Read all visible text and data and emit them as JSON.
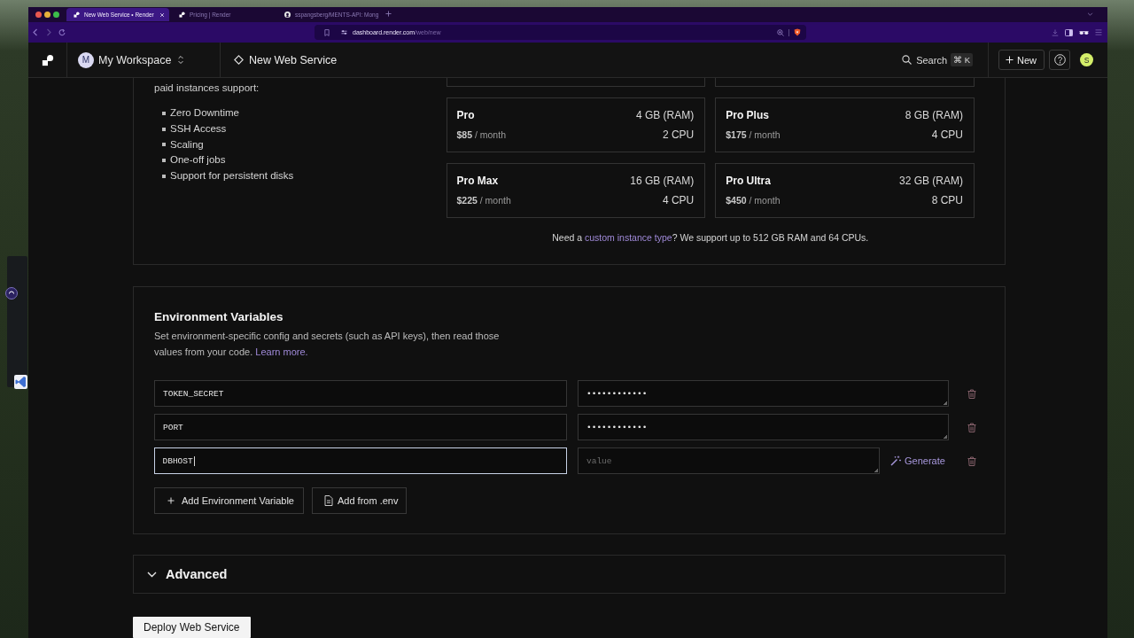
{
  "browser": {
    "tabs": [
      {
        "title": "New Web Service • Render",
        "kind": "blocks",
        "selected": true,
        "closable": true
      },
      {
        "title": "Pricing | Render",
        "kind": "blocks",
        "selected": false,
        "closable": false
      },
      {
        "title": "sspangsberg/MENTS-API: Mong",
        "kind": "round",
        "selected": false,
        "closable": false
      }
    ],
    "url": {
      "host": "dashboard.render.com",
      "path": "/web/new"
    }
  },
  "header": {
    "workspace": {
      "initial": "M",
      "name": "My Workspace"
    },
    "page_title": "New Web Service",
    "search": {
      "label": "Search",
      "shortcut": "⌘ K"
    },
    "new_button": "New",
    "user_initial": "S"
  },
  "instances": {
    "intro": "paid instances support:",
    "features": [
      "Zero Downtime",
      "SSH Access",
      "Scaling",
      "One-off jobs",
      "Support for persistent disks"
    ],
    "types": [
      {
        "kind": "partial"
      },
      {
        "kind": "partial"
      },
      {
        "kind": "full",
        "name": "Pro",
        "ram": "4 GB (RAM)",
        "price": "**$85** / month",
        "cpu": "2 CPU"
      },
      {
        "kind": "full",
        "name": "Pro Plus",
        "ram": "8 GB (RAM)",
        "price": "**$175** / month",
        "cpu": "4 CPU"
      },
      {
        "kind": "full",
        "name": "Pro Max",
        "ram": "16 GB (RAM)",
        "price": "**$225** / month",
        "cpu": "4 CPU"
      },
      {
        "kind": "full",
        "name": "Pro Ultra",
        "ram": "32 GB (RAM)",
        "price": "**$450** / month",
        "cpu": "8 CPU"
      }
    ],
    "note": {
      "before": "Need a ",
      "link": "custom instance type",
      "after": "? We support up to 512 GB RAM and 64 CPUs."
    }
  },
  "env": {
    "title": "Environment Variables",
    "description": "Set environment-specific config and secrets (such as API keys), then read those values from your code.",
    "link": "Learn more.",
    "rows": [
      {
        "key": "TOKEN_SECRET",
        "value": "••••••••••••",
        "focused": false
      },
      {
        "key": "PORT",
        "value": "••••••••••••",
        "focused": false
      },
      {
        "key": "DBHOST",
        "placeholder": "value",
        "focused": true,
        "generate": "Generate"
      }
    ],
    "buttons": [
      {
        "kind": "add",
        "label": "Add Environment Variable"
      },
      {
        "kind": "file",
        "label": "Add from .env"
      }
    ]
  },
  "advanced": {
    "title": "Advanced",
    "expanded": false
  },
  "deploy_button": "Deploy Web Service"
}
